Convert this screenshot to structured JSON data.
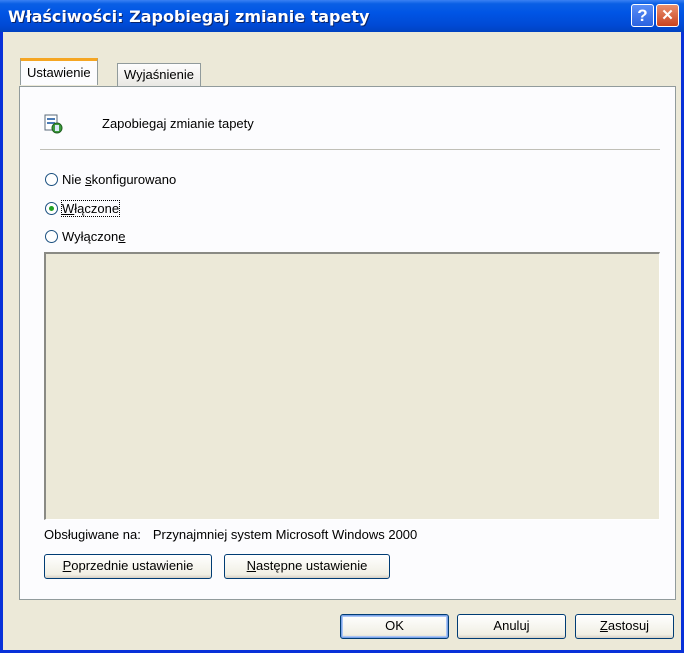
{
  "window": {
    "title": "Właściwości: Zapobiegaj zmianie tapety",
    "help_label": "?",
    "close_label": "✕"
  },
  "tabs": [
    {
      "label": "Ustawienie",
      "active": true
    },
    {
      "label": "Wyjaśnienie",
      "active": false
    }
  ],
  "policy": {
    "name": "Zapobiegaj zmianie tapety",
    "icon": "policy-setting-icon"
  },
  "radios": {
    "not_configured": {
      "pre": "Nie ",
      "accel": "s",
      "post": "konfigurowano",
      "checked": false
    },
    "enabled": {
      "pre": "",
      "accel": "W",
      "post": "łączone",
      "checked": true
    },
    "disabled": {
      "pre": "Wyłączon",
      "accel": "e",
      "post": "",
      "checked": false
    }
  },
  "supported": {
    "label": "Obsługiwane na:",
    "value": "Przynajmniej system Microsoft Windows 2000"
  },
  "nav_buttons": {
    "previous": {
      "accel": "P",
      "rest": "oprzednie ustawienie"
    },
    "next": {
      "accel": "N",
      "rest": "astępne ustawienie"
    }
  },
  "dialog_buttons": {
    "ok": "OK",
    "cancel": "Anuluj",
    "apply": {
      "accel": "Z",
      "rest": "astosuj"
    }
  },
  "colors": {
    "titlebar": "#0055e5",
    "tab_highlight": "#f5a623",
    "radio_dot": "#21a121"
  }
}
